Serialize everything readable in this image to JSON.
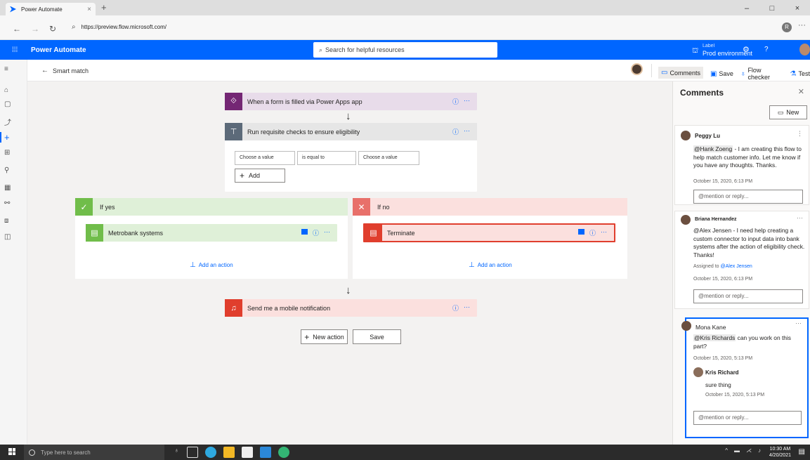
{
  "browser": {
    "tab_title": "Power Automate",
    "tab_close": "×",
    "new_tab": "+",
    "url": "https://preview.flow.microsoft.com/",
    "profile_initial": "R",
    "more": "···",
    "window_controls": [
      "–",
      "□",
      "×"
    ]
  },
  "app": {
    "name": "Power Automate",
    "search_placeholder": "Search for helpful resources",
    "environment_label": "Label",
    "environment_name": "Prod environment",
    "help": "?"
  },
  "commandbar": {
    "back_label": "Smart match",
    "comments": "Comments",
    "save": "Save",
    "flow_checker": "Flow checker",
    "test": "Test"
  },
  "flow": {
    "trigger": "When a form is filled via Power Apps app",
    "condition": {
      "title": "Run requisite checks to ensure eligibility",
      "left_value": "Choose a value",
      "operator": "is equal to",
      "right_value": "Choose a value",
      "add_label": "Add"
    },
    "branch_yes": {
      "title": "If yes",
      "action": "Metrobank systems",
      "add_action": "Add an action"
    },
    "branch_no": {
      "title": "If no",
      "action": "Terminate",
      "add_action": "Add an action"
    },
    "notification": "Send me a mobile notification",
    "new_action": "New action",
    "save": "Save",
    "colors": {
      "trigger": "#742774",
      "condition": "#5c6a79",
      "yes": "#70bd4a",
      "no": "#e8706a",
      "terminate": "#e03e2d",
      "notify": "#e03e2d",
      "accent": "#0066ff"
    }
  },
  "comments": {
    "title": "Comments",
    "new_label": "New",
    "items": [
      {
        "author": "Peggy Lu",
        "mention": "@Hank Zoeng",
        "text": " - I am creating this flow to help match customer info. Let me know if you have any thoughts. Thanks.",
        "time": "October 15, 2020, 6:13 PM",
        "reply_placeholder": "@mention or reply..."
      },
      {
        "author": "Briana Hernandez",
        "text": "@Alex Jensen - I need help creating a custom connector to input data into bank systems after the action of eligibility check. Thanks!",
        "assigned_prefix": "Assigned to ",
        "assigned_to": "@Alex Jensen",
        "time": "October 15, 2020, 6:13 PM",
        "reply_placeholder": "@mention or reply..."
      },
      {
        "author": "Mona Kane",
        "mention": "@Kris Richards",
        "text": " can you work on this part?",
        "time": "October 15, 2020, 5:13 PM",
        "reply_author": "Kris Richard",
        "reply_text": "sure thing",
        "reply_time": "October 15, 2020, 5:13 PM",
        "reply_placeholder": "@mention or reply..."
      }
    ]
  },
  "taskbar": {
    "search_placeholder": "Type here to search",
    "time": "10:30 AM",
    "date": "4/20/2021"
  }
}
